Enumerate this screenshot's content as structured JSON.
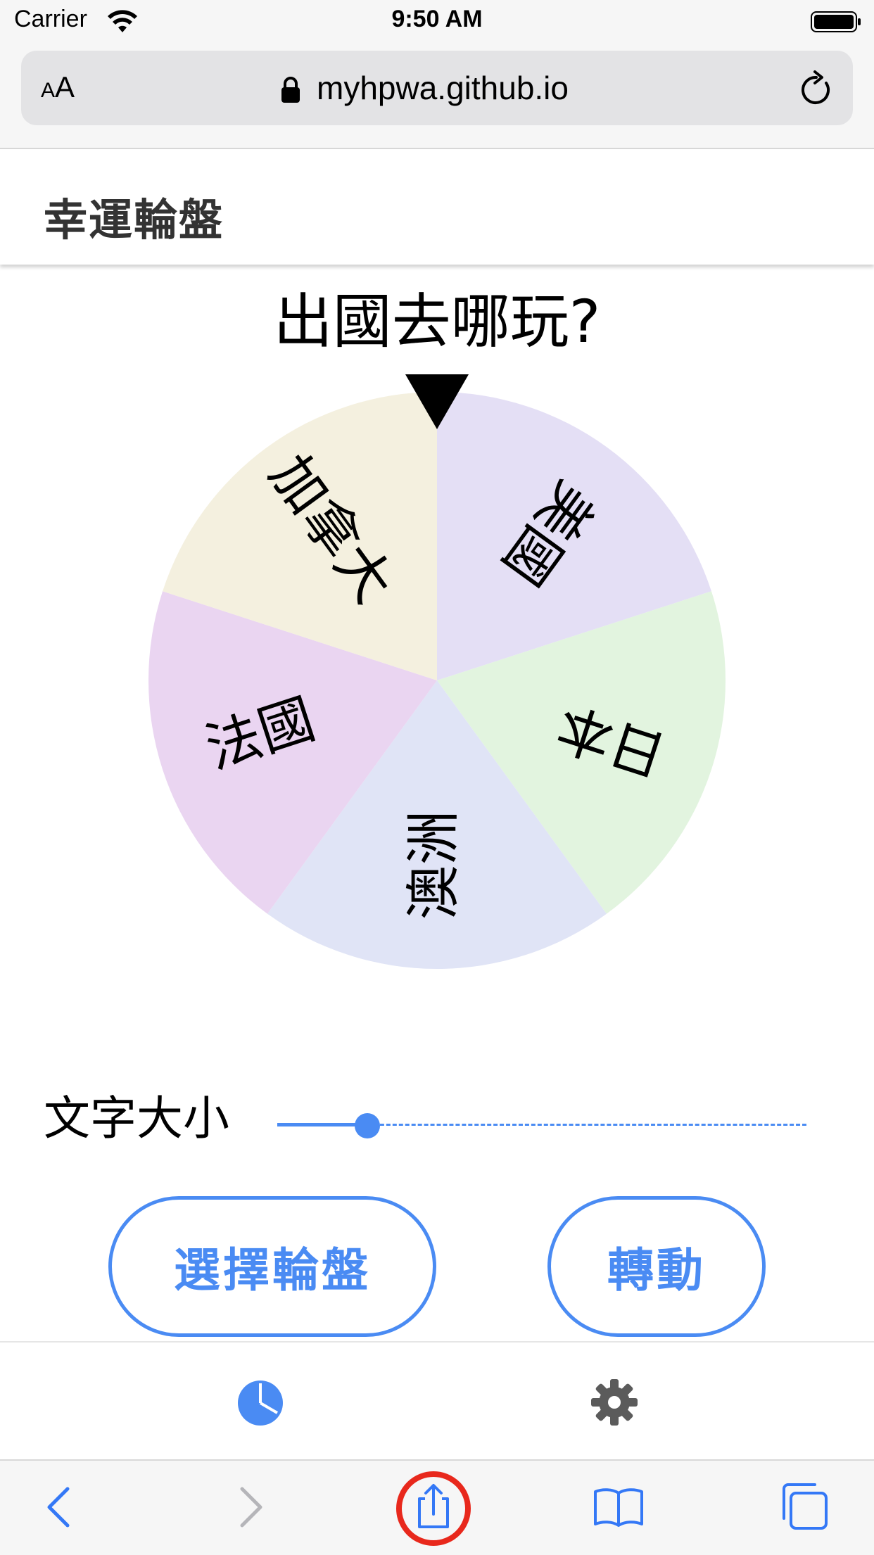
{
  "status_bar": {
    "carrier": "Carrier",
    "time": "9:50 AM"
  },
  "browser": {
    "reader_label_small": "A",
    "reader_label_large": "A",
    "url": "myhpwa.github.io"
  },
  "app": {
    "title": "幸運輪盤"
  },
  "wheel": {
    "title": "出國去哪玩?",
    "segments": [
      {
        "label": "美國",
        "color": "#e4dff5"
      },
      {
        "label": "日本",
        "color": "#e2f4df"
      },
      {
        "label": "澳洲",
        "color": "#e0e4f6"
      },
      {
        "label": "法國",
        "color": "#ead5f1"
      },
      {
        "label": "加拿大",
        "color": "#f4f0df"
      }
    ],
    "pointer_color": "#000000"
  },
  "controls": {
    "font_size_label": "文字大小",
    "font_size_slider_fraction": 0.17,
    "select_wheel_label": "選擇輪盤",
    "spin_label": "轉動",
    "accent_color": "#4a8bf3"
  },
  "app_nav": {
    "items": [
      {
        "icon": "pie-chart-icon",
        "active": true
      },
      {
        "icon": "gear-icon",
        "active": false
      }
    ]
  },
  "safari_toolbar": {
    "items": [
      "back-icon",
      "forward-icon",
      "share-icon",
      "bookmarks-icon",
      "tabs-icon"
    ],
    "highlight_color": "#e8281c"
  }
}
